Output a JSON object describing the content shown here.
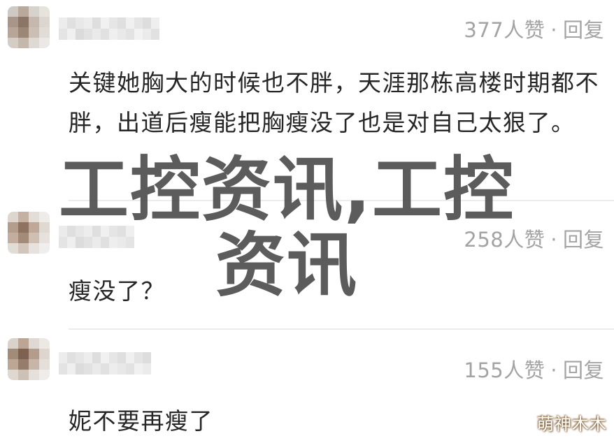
{
  "comments": [
    {
      "likes_text": "377人赞",
      "separator": "·",
      "reply_label": "回复",
      "text": "关键她胸大的时候也不胖，天涯那栋高楼时期都不胖，出道后瘦能把胸瘦没了也是对自己太狠了。"
    },
    {
      "likes_text": "258人赞",
      "separator": "·",
      "reply_label": "回复",
      "text": "瘦没了？"
    },
    {
      "likes_text": "155人赞",
      "separator": "·",
      "reply_label": "回复",
      "text": "妮不要再瘦了"
    }
  ],
  "overlay_text": "工控资讯,工控资讯",
  "watermark": "萌神木木",
  "colors": {
    "meta_gray": "#a3a3a3",
    "body_text": "#262626",
    "divider": "#ececec",
    "overlay": "#464646"
  },
  "icons": {
    "avatar": "pixelated-avatar",
    "username": "pixelated-username"
  }
}
